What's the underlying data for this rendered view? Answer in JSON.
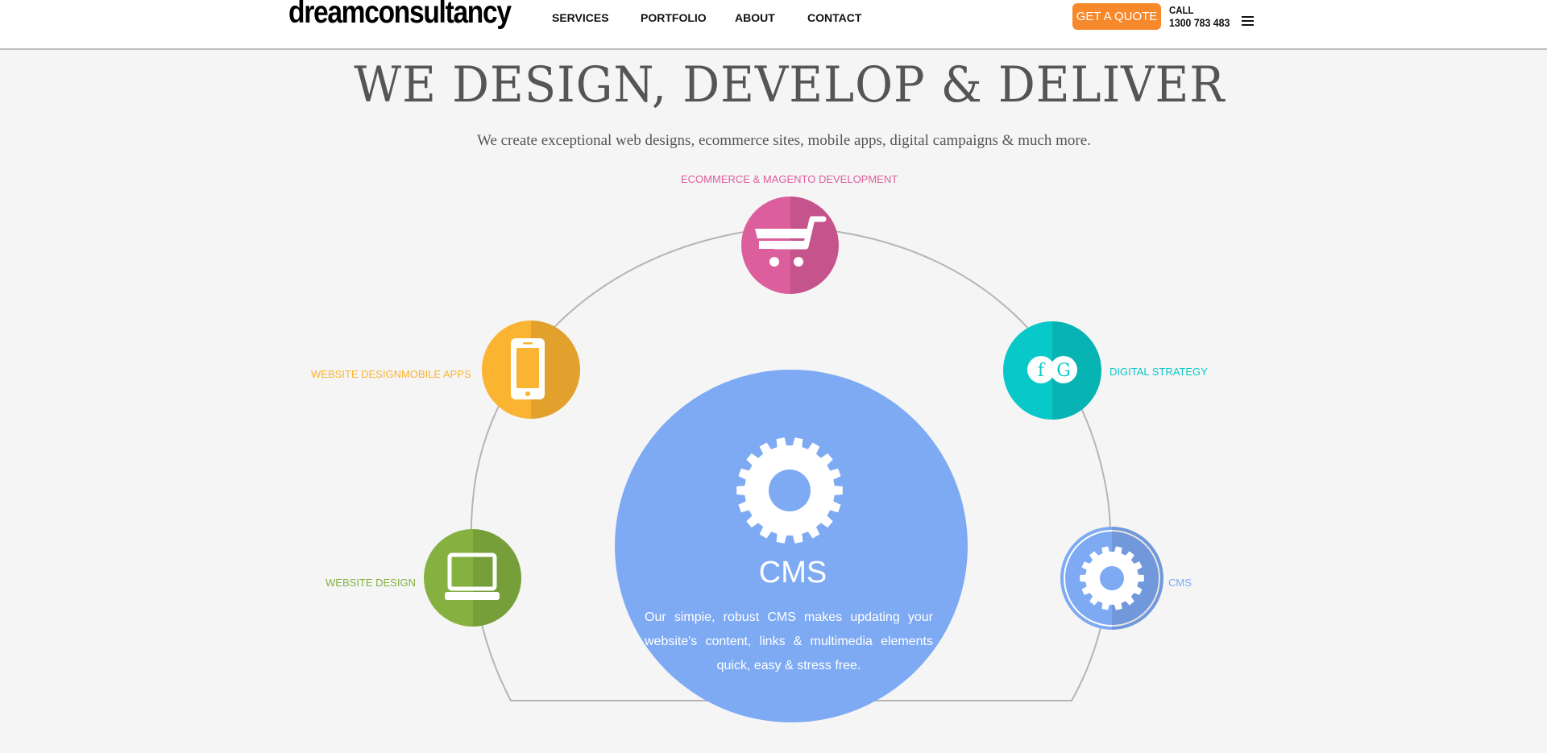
{
  "header": {
    "logo": "dreamconsultancy",
    "nav": [
      "SERVICES",
      "PORTFOLIO",
      "ABOUT",
      "CONTACT"
    ],
    "quote_button": "GET A QUOTE",
    "call_label": "CALL",
    "call_number": "1300 783 483",
    "menu_icon": "hamburger-menu-icon"
  },
  "hero": {
    "title": "WE DESIGN, DEVELOP & DELIVER",
    "subtitle": "We create exceptional web designs, ecommerce sites, mobile apps, digital campaigns & much more."
  },
  "services": [
    {
      "label": "ECOMMERCE & MAGENTO DEVELOPMENT",
      "icon": "shopping-cart-icon",
      "color": "#dd5e9c"
    },
    {
      "label": "WEBSITE DESIGNMOBILE APPS",
      "icon": "smartphone-icon",
      "color": "#fbb431"
    },
    {
      "label": "DIGITAL STRATEGY",
      "icon": "social-media-icon",
      "color": "#09c8c9"
    },
    {
      "label": "WEBSITE DESIGN",
      "icon": "laptop-icon",
      "color": "#84b140"
    },
    {
      "label": "CMS",
      "icon": "gear-icon",
      "color": "#7eaaf4"
    }
  ],
  "social_icon_letters": {
    "facebook": "f",
    "google": "G"
  },
  "featured": {
    "title": "CMS",
    "description": "Our simpie, robust CMS makes updating your website's content, links & multimedia elements quick, easy & stress free.",
    "icon": "gear-icon",
    "color": "#7eaaf4"
  },
  "colors": {
    "accent": "#f7892c",
    "arc": "#b5b5b5",
    "background": "#f5f5f5"
  }
}
